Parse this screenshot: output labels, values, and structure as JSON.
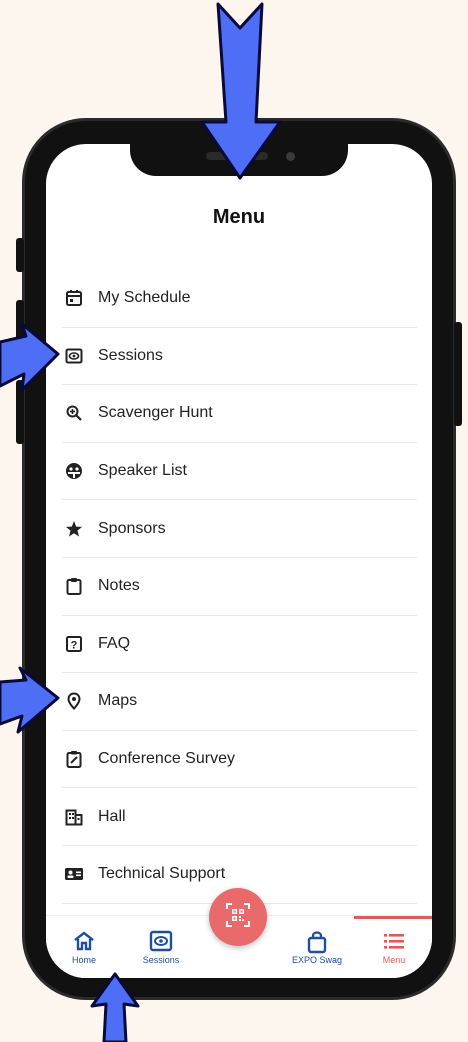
{
  "screen": {
    "title": "Menu"
  },
  "menu": {
    "items": [
      {
        "label": "My Schedule",
        "icon": "calendar-icon"
      },
      {
        "label": "Sessions",
        "icon": "eye-icon"
      },
      {
        "label": "Scavenger Hunt",
        "icon": "magnify-icon"
      },
      {
        "label": "Speaker List",
        "icon": "speaker-face-icon"
      },
      {
        "label": "Sponsors",
        "icon": "star-icon"
      },
      {
        "label": "Notes",
        "icon": "clipboard-icon"
      },
      {
        "label": "FAQ",
        "icon": "question-icon"
      },
      {
        "label": "Maps",
        "icon": "map-pin-icon"
      },
      {
        "label": "Conference Survey",
        "icon": "survey-icon"
      },
      {
        "label": "Hall",
        "icon": "building-icon"
      },
      {
        "label": "Technical Support",
        "icon": "id-card-icon"
      }
    ]
  },
  "tabbar": {
    "tabs": [
      {
        "label": "Home",
        "icon": "home-icon"
      },
      {
        "label": "Sessions",
        "icon": "eye-icon"
      },
      {
        "label": "EXPO Swag",
        "icon": "bag-icon"
      },
      {
        "label": "Menu",
        "icon": "list-icon",
        "active": true
      }
    ],
    "center_action_icon": "qr-code-icon"
  },
  "colors": {
    "background": "#fdf6ee",
    "arrow": "#4d6ef5",
    "accent": "#e86a6a",
    "tab_text": "#1f4e9e"
  }
}
